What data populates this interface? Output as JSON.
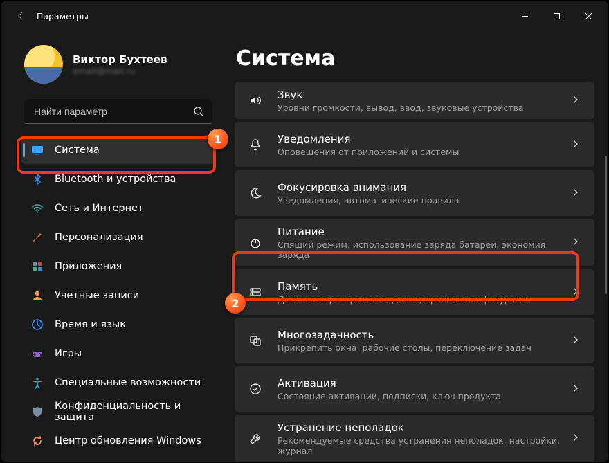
{
  "window": {
    "title": "Параметры"
  },
  "profile": {
    "name": "Виктор Бухтеев",
    "email": "email@mail.ru"
  },
  "search": {
    "placeholder": "Найти параметр"
  },
  "nav": {
    "items": [
      {
        "label": "Система",
        "icon": "display-icon",
        "color": "#3aa0ff",
        "active": true
      },
      {
        "label": "Bluetooth и устройства",
        "icon": "bluetooth-icon",
        "color": "#3a8de0"
      },
      {
        "label": "Сеть и Интернет",
        "icon": "wifi-icon",
        "color": "#2bc4b2"
      },
      {
        "label": "Персонализация",
        "icon": "brush-icon",
        "color": "#d47a3a"
      },
      {
        "label": "Приложения",
        "icon": "apps-icon",
        "color": "#7a8ea3"
      },
      {
        "label": "Учетные записи",
        "icon": "person-icon",
        "color": "#ff9a4d"
      },
      {
        "label": "Время и язык",
        "icon": "clock-globe-icon",
        "color": "#3aa0ff"
      },
      {
        "label": "Игры",
        "icon": "game-icon",
        "color": "#8a62c9"
      },
      {
        "label": "Специальные возможности",
        "icon": "accessibility-icon",
        "color": "#2fa8d8"
      },
      {
        "label": "Конфиденциальность и защита",
        "icon": "shield-icon",
        "color": "#7a8ea3"
      },
      {
        "label": "Центр обновления Windows",
        "icon": "update-icon",
        "color": "#ff8a4d"
      }
    ]
  },
  "page": {
    "title": "Система"
  },
  "rows": [
    {
      "icon": "sound-icon",
      "title": "Звук",
      "sub": "Уровни громкости, вывод, ввод, звуковые устройства",
      "short": true
    },
    {
      "icon": "bell-icon",
      "title": "Уведомления",
      "sub": "Оповещения от приложений и системы"
    },
    {
      "icon": "moon-icon",
      "title": "Фокусировка внимания",
      "sub": "Уведомления, автоматические правила"
    },
    {
      "icon": "power-icon",
      "title": "Питание",
      "sub": "Спящий режим, использование заряда батареи, экономия заряда",
      "highlight": true
    },
    {
      "icon": "storage-icon",
      "title": "Память",
      "sub": "Дисковое пространство, диски, правила конфигурации"
    },
    {
      "icon": "multitask-icon",
      "title": "Многозадачность",
      "sub": "Прикрепить окна, рабочие столы, переключение задач"
    },
    {
      "icon": "activation-icon",
      "title": "Активация",
      "sub": "Состояние активации, подписки, ключ продукта"
    },
    {
      "icon": "troubleshoot-icon",
      "title": "Устранение неполадок",
      "sub": "Рекомендуемые средства устранения неполадок, настройки, журнал",
      "short": true
    }
  ],
  "badges": {
    "one": "1",
    "two": "2"
  }
}
